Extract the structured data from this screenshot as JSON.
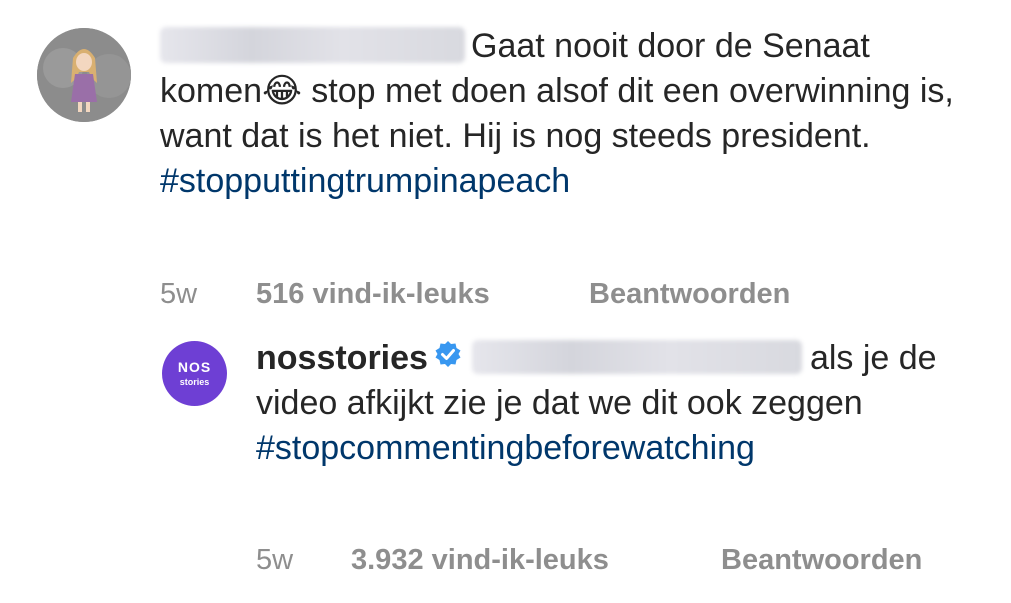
{
  "comment1": {
    "avatar_icon": "user-avatar-illustration-icon",
    "username_redacted": true,
    "text": "Gaat nooit door de Senaat komen",
    "emoji": "😂",
    "text_cont": " stop met doen alsof dit een overwinning is, want dat is het niet. Hij is nog steeds president.",
    "hashtag": "#stopputtingtrumpinapeach",
    "time": "5w",
    "likes": "516 vind-ik-leuks",
    "reply": "Beantwoorden"
  },
  "comment2": {
    "avatar_text": "NOS",
    "avatar_subtext": "stories",
    "username": "nosstories",
    "verified_icon": "verified-badge-icon",
    "mention_redacted": true,
    "text": "als je de video afkijkt zie je dat we dit ook zeggen",
    "hashtag": "#stopcommentingbeforewatching",
    "time": "5w",
    "likes": "3.932 vind-ik-leuks",
    "reply": "Beantwoorden"
  },
  "colors": {
    "text": "#262626",
    "hashtag": "#00376b",
    "meta": "#8e8e8e",
    "verified": "#3897f0",
    "nos_purple": "#6e3fd4"
  }
}
